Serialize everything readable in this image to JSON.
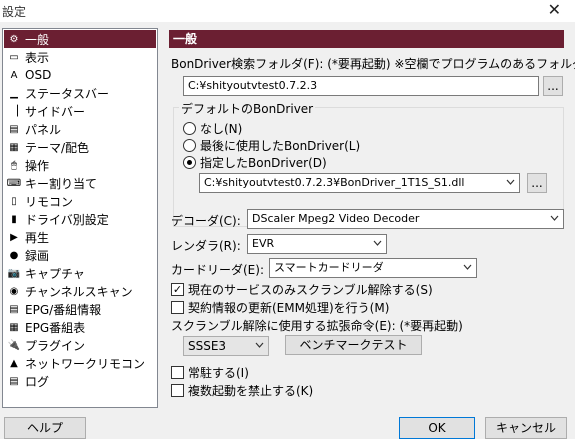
{
  "window": {
    "title": "設定",
    "close_glyph": "✕"
  },
  "sidebar": {
    "items": [
      {
        "label": "一般",
        "icon": "gear-icon",
        "glyph": "⚙"
      },
      {
        "label": "表示",
        "icon": "display-icon",
        "glyph": "▭"
      },
      {
        "label": "OSD",
        "icon": "osd-icon",
        "glyph": "A"
      },
      {
        "label": "ステータスバー",
        "icon": "statusbar-icon",
        "glyph": "▁"
      },
      {
        "label": "サイドバー",
        "icon": "sidebar-icon",
        "glyph": "▕"
      },
      {
        "label": "パネル",
        "icon": "panel-icon",
        "glyph": "▤"
      },
      {
        "label": "テーマ/配色",
        "icon": "palette-icon",
        "glyph": "▦"
      },
      {
        "label": "操作",
        "icon": "mouse-icon",
        "glyph": "🖱"
      },
      {
        "label": "キー割り当て",
        "icon": "keyboard-icon",
        "glyph": "⌨"
      },
      {
        "label": "リモコン",
        "icon": "remote-icon",
        "glyph": "▯"
      },
      {
        "label": "ドライバ別設定",
        "icon": "driver-icon",
        "glyph": "▮"
      },
      {
        "label": "再生",
        "icon": "play-icon",
        "glyph": "▶"
      },
      {
        "label": "録画",
        "icon": "record-icon",
        "glyph": "●"
      },
      {
        "label": "キャプチャ",
        "icon": "camera-icon",
        "glyph": "📷"
      },
      {
        "label": "チャンネルスキャン",
        "icon": "scan-icon",
        "glyph": "◉"
      },
      {
        "label": "EPG/番組情報",
        "icon": "epg-icon",
        "glyph": "▤"
      },
      {
        "label": "EPG番組表",
        "icon": "epg-table-icon",
        "glyph": "▦"
      },
      {
        "label": "プラグイン",
        "icon": "plugin-icon",
        "glyph": "🔌"
      },
      {
        "label": "ネットワークリモコン",
        "icon": "network-icon",
        "glyph": "▲"
      },
      {
        "label": "ログ",
        "icon": "log-icon",
        "glyph": "▤"
      }
    ]
  },
  "general": {
    "header": "一般",
    "bondriver_folder_label": "BonDriver検索フォルダ(F): (*要再起動)  ※空欄でプログラムのあるフォルダ",
    "bondriver_folder_value": "C:¥shityoutvtest0.7.2.3",
    "browse_label": "...",
    "default_group_title": "デフォルトのBonDriver",
    "radio_none": "なし(N)",
    "radio_last": "最後に使用したBonDriver(L)",
    "radio_specified": "指定したBonDriver(D)",
    "bondriver_path": "C:¥shityoutvtest0.7.2.3¥BonDriver_1T1S_S1.dll",
    "decoder_label": "デコーダ(C):",
    "decoder_value": "DScaler Mpeg2 Video Decoder",
    "renderer_label": "レンダラ(R):",
    "renderer_value": "EVR",
    "card_reader_label": "カードリーダ(E):",
    "card_reader_value": "スマートカードリーダ",
    "descramble_current_label": "現在のサービスのみスクランブル解除する(S)",
    "emm_label": "契約情報の更新(EMM処理)を行う(M)",
    "extension_label": "スクランブル解除に使用する拡張命令(E): (*要再起動)",
    "extension_value": "SSSE3",
    "benchmark_label": "ベンチマークテスト",
    "always_on_top_label": "常駐する(I)",
    "prevent_multi_label": "複数起動を禁止する(K)"
  },
  "footer": {
    "help": "ヘルプ",
    "ok": "OK",
    "cancel": "キャンセル"
  }
}
